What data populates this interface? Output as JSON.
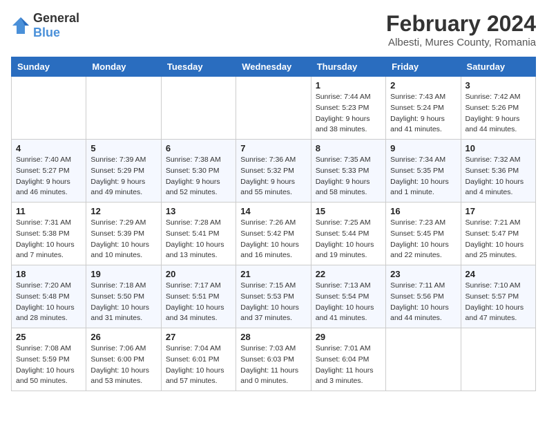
{
  "logo": {
    "general": "General",
    "blue": "Blue"
  },
  "header": {
    "title": "February 2024",
    "subtitle": "Albesti, Mures County, Romania"
  },
  "calendar": {
    "days_of_week": [
      "Sunday",
      "Monday",
      "Tuesday",
      "Wednesday",
      "Thursday",
      "Friday",
      "Saturday"
    ],
    "weeks": [
      [
        {
          "day": "",
          "info": ""
        },
        {
          "day": "",
          "info": ""
        },
        {
          "day": "",
          "info": ""
        },
        {
          "day": "",
          "info": ""
        },
        {
          "day": "1",
          "info": "Sunrise: 7:44 AM\nSunset: 5:23 PM\nDaylight: 9 hours\nand 38 minutes."
        },
        {
          "day": "2",
          "info": "Sunrise: 7:43 AM\nSunset: 5:24 PM\nDaylight: 9 hours\nand 41 minutes."
        },
        {
          "day": "3",
          "info": "Sunrise: 7:42 AM\nSunset: 5:26 PM\nDaylight: 9 hours\nand 44 minutes."
        }
      ],
      [
        {
          "day": "4",
          "info": "Sunrise: 7:40 AM\nSunset: 5:27 PM\nDaylight: 9 hours\nand 46 minutes."
        },
        {
          "day": "5",
          "info": "Sunrise: 7:39 AM\nSunset: 5:29 PM\nDaylight: 9 hours\nand 49 minutes."
        },
        {
          "day": "6",
          "info": "Sunrise: 7:38 AM\nSunset: 5:30 PM\nDaylight: 9 hours\nand 52 minutes."
        },
        {
          "day": "7",
          "info": "Sunrise: 7:36 AM\nSunset: 5:32 PM\nDaylight: 9 hours\nand 55 minutes."
        },
        {
          "day": "8",
          "info": "Sunrise: 7:35 AM\nSunset: 5:33 PM\nDaylight: 9 hours\nand 58 minutes."
        },
        {
          "day": "9",
          "info": "Sunrise: 7:34 AM\nSunset: 5:35 PM\nDaylight: 10 hours\nand 1 minute."
        },
        {
          "day": "10",
          "info": "Sunrise: 7:32 AM\nSunset: 5:36 PM\nDaylight: 10 hours\nand 4 minutes."
        }
      ],
      [
        {
          "day": "11",
          "info": "Sunrise: 7:31 AM\nSunset: 5:38 PM\nDaylight: 10 hours\nand 7 minutes."
        },
        {
          "day": "12",
          "info": "Sunrise: 7:29 AM\nSunset: 5:39 PM\nDaylight: 10 hours\nand 10 minutes."
        },
        {
          "day": "13",
          "info": "Sunrise: 7:28 AM\nSunset: 5:41 PM\nDaylight: 10 hours\nand 13 minutes."
        },
        {
          "day": "14",
          "info": "Sunrise: 7:26 AM\nSunset: 5:42 PM\nDaylight: 10 hours\nand 16 minutes."
        },
        {
          "day": "15",
          "info": "Sunrise: 7:25 AM\nSunset: 5:44 PM\nDaylight: 10 hours\nand 19 minutes."
        },
        {
          "day": "16",
          "info": "Sunrise: 7:23 AM\nSunset: 5:45 PM\nDaylight: 10 hours\nand 22 minutes."
        },
        {
          "day": "17",
          "info": "Sunrise: 7:21 AM\nSunset: 5:47 PM\nDaylight: 10 hours\nand 25 minutes."
        }
      ],
      [
        {
          "day": "18",
          "info": "Sunrise: 7:20 AM\nSunset: 5:48 PM\nDaylight: 10 hours\nand 28 minutes."
        },
        {
          "day": "19",
          "info": "Sunrise: 7:18 AM\nSunset: 5:50 PM\nDaylight: 10 hours\nand 31 minutes."
        },
        {
          "day": "20",
          "info": "Sunrise: 7:17 AM\nSunset: 5:51 PM\nDaylight: 10 hours\nand 34 minutes."
        },
        {
          "day": "21",
          "info": "Sunrise: 7:15 AM\nSunset: 5:53 PM\nDaylight: 10 hours\nand 37 minutes."
        },
        {
          "day": "22",
          "info": "Sunrise: 7:13 AM\nSunset: 5:54 PM\nDaylight: 10 hours\nand 41 minutes."
        },
        {
          "day": "23",
          "info": "Sunrise: 7:11 AM\nSunset: 5:56 PM\nDaylight: 10 hours\nand 44 minutes."
        },
        {
          "day": "24",
          "info": "Sunrise: 7:10 AM\nSunset: 5:57 PM\nDaylight: 10 hours\nand 47 minutes."
        }
      ],
      [
        {
          "day": "25",
          "info": "Sunrise: 7:08 AM\nSunset: 5:59 PM\nDaylight: 10 hours\nand 50 minutes."
        },
        {
          "day": "26",
          "info": "Sunrise: 7:06 AM\nSunset: 6:00 PM\nDaylight: 10 hours\nand 53 minutes."
        },
        {
          "day": "27",
          "info": "Sunrise: 7:04 AM\nSunset: 6:01 PM\nDaylight: 10 hours\nand 57 minutes."
        },
        {
          "day": "28",
          "info": "Sunrise: 7:03 AM\nSunset: 6:03 PM\nDaylight: 11 hours\nand 0 minutes."
        },
        {
          "day": "29",
          "info": "Sunrise: 7:01 AM\nSunset: 6:04 PM\nDaylight: 11 hours\nand 3 minutes."
        },
        {
          "day": "",
          "info": ""
        },
        {
          "day": "",
          "info": ""
        }
      ]
    ]
  }
}
